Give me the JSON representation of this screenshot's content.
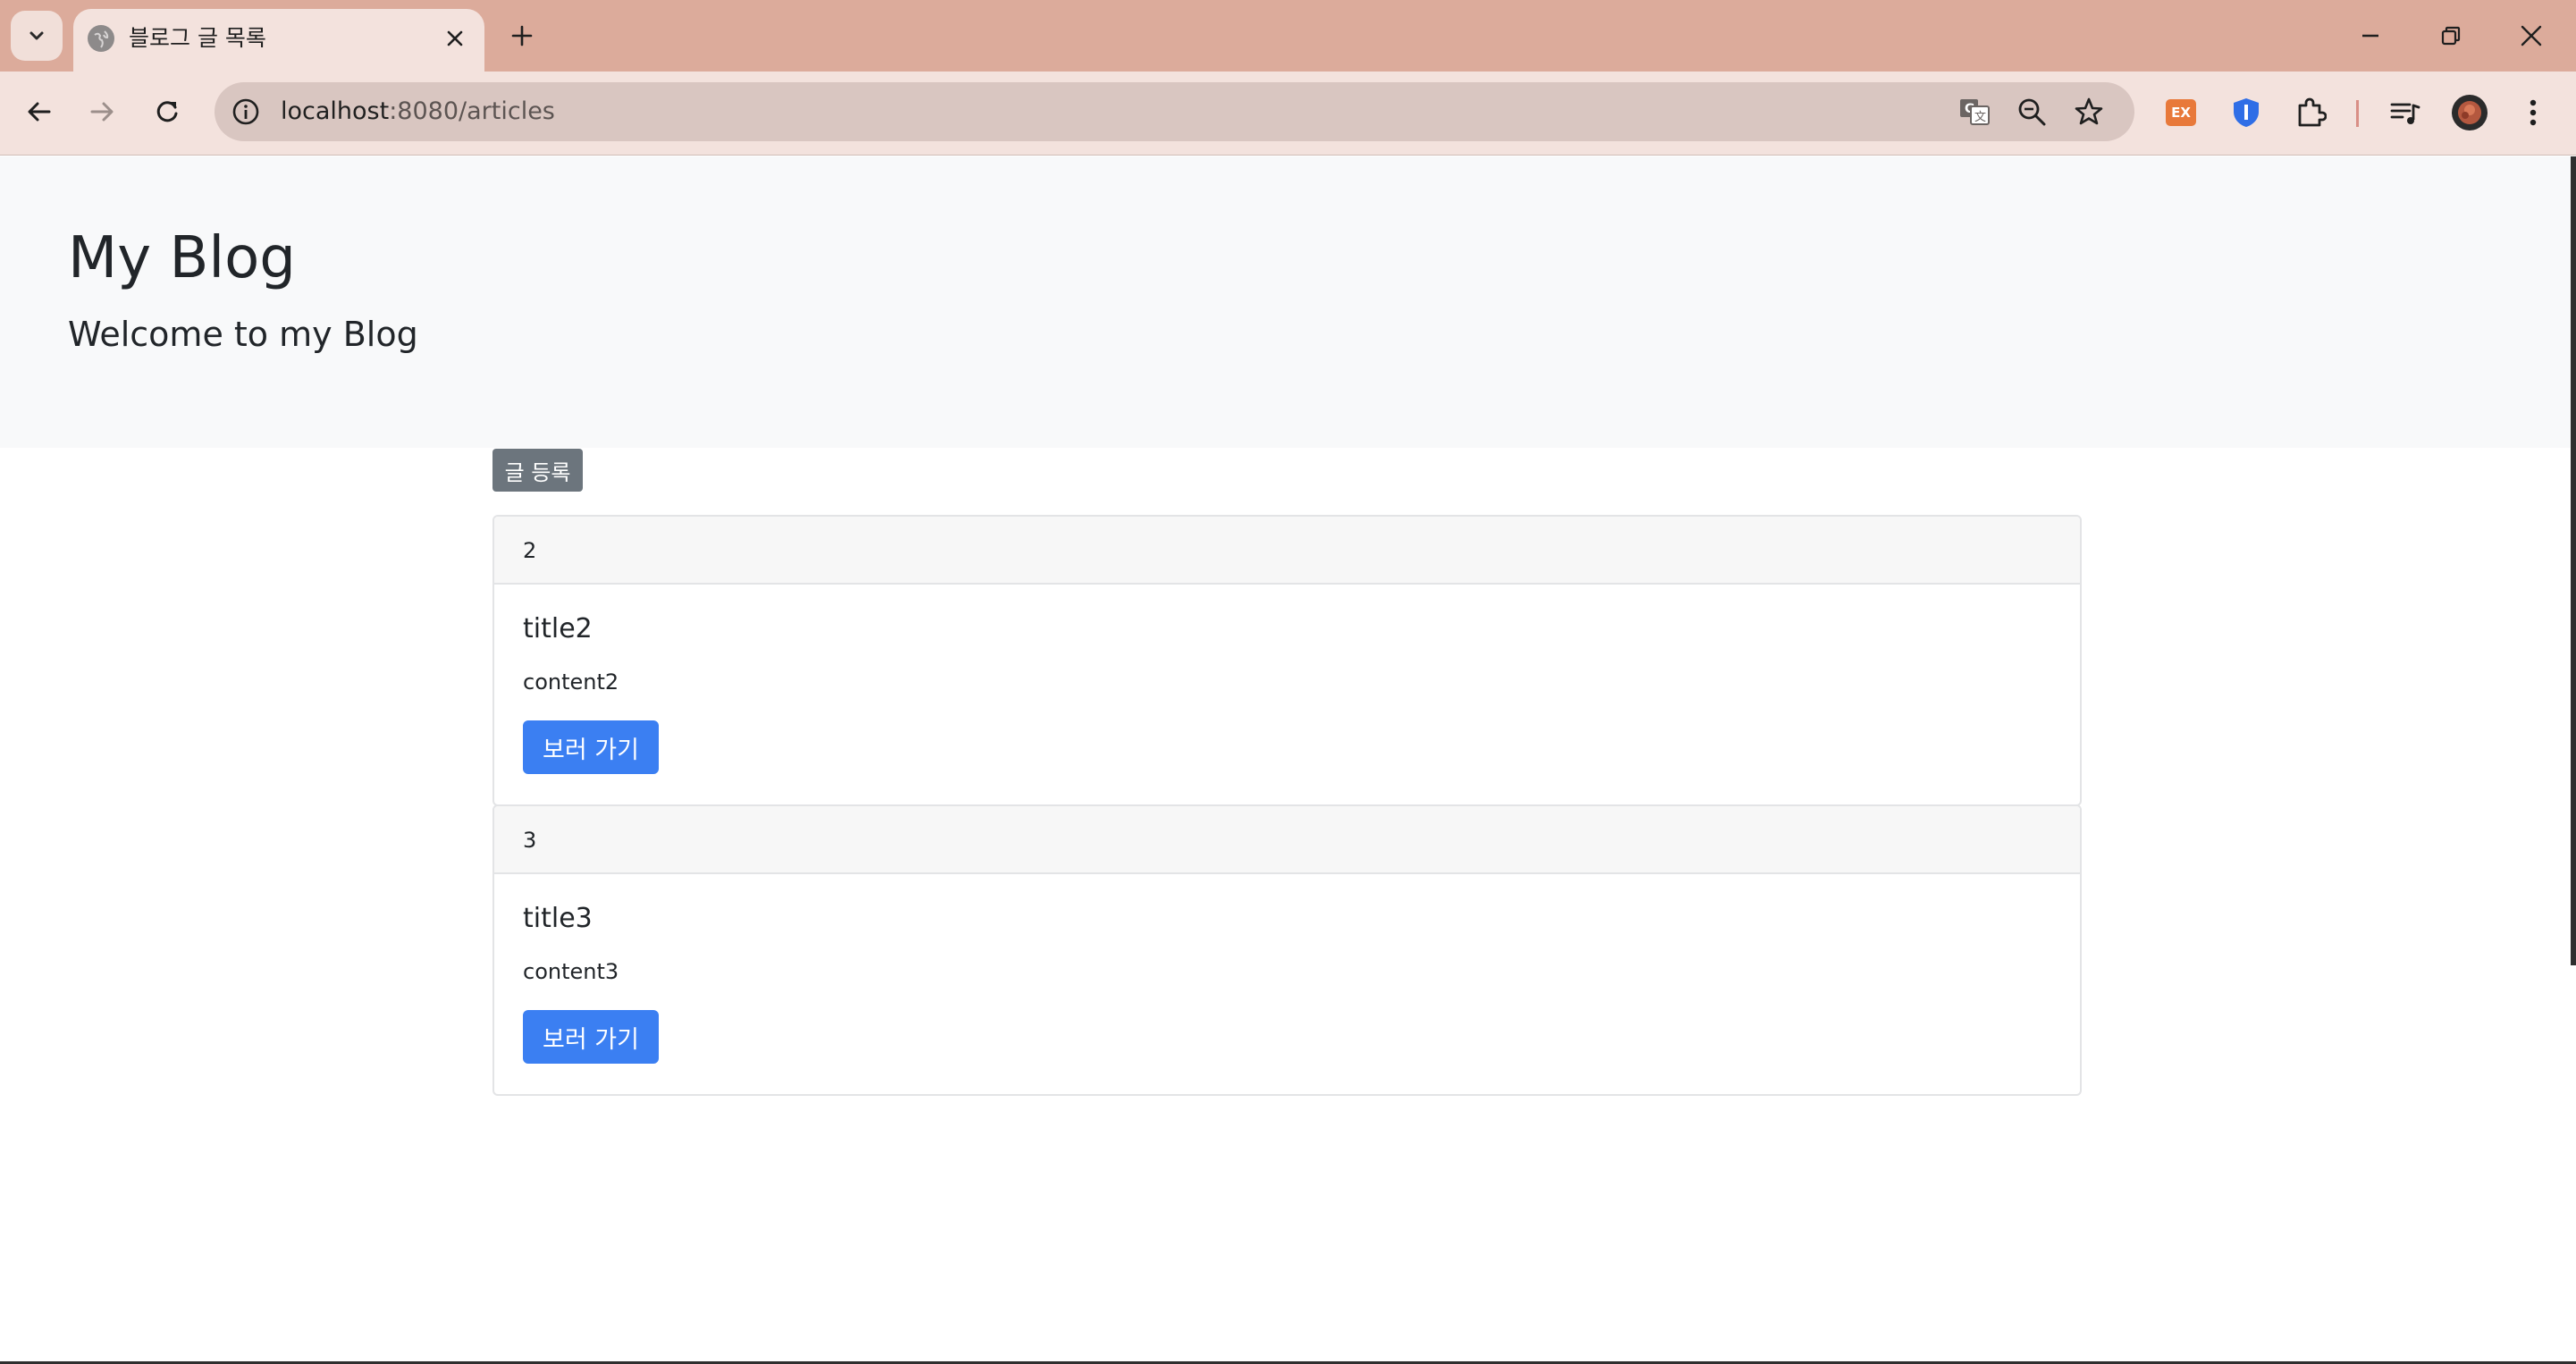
{
  "browser": {
    "tab_title": "블로그 글 목록",
    "url_host": "localhost",
    "url_path": ":8080/articles",
    "theme": {
      "tabstrip": "#dcab9b",
      "toolbar": "#f3e2dd",
      "omnibox": "#d9c6c1"
    },
    "extensions": [
      {
        "name": "ex-extension-icon",
        "label": "EX",
        "color": "#e8793a"
      },
      {
        "name": "shield-extension-icon",
        "label": "!",
        "color": "#2f6ee6"
      }
    ]
  },
  "page": {
    "blog_title": "My Blog",
    "blog_subtitle": "Welcome to my Blog",
    "register_button": "글 등록",
    "articles": [
      {
        "id": "2",
        "title": "title2",
        "content": "content2",
        "view_button": "보러 가기"
      },
      {
        "id": "3",
        "title": "title3",
        "content": "content3",
        "view_button": "보러 가기"
      }
    ]
  }
}
